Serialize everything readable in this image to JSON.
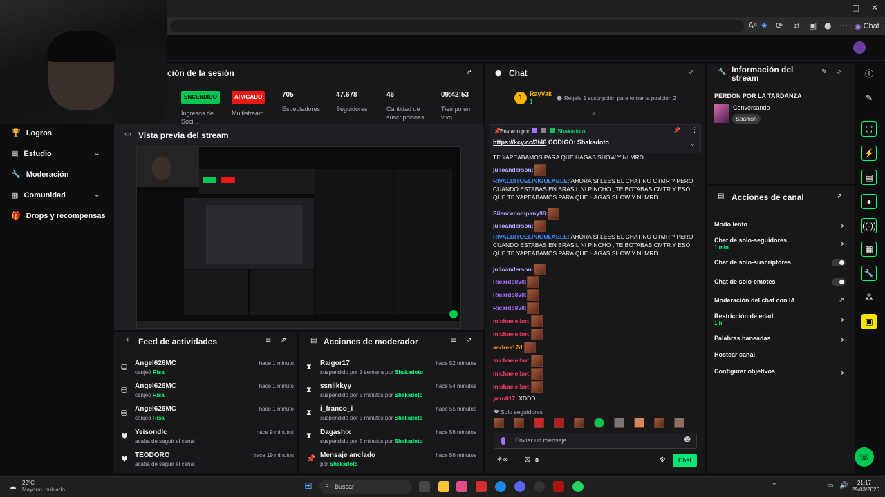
{
  "browser": {
    "chat_label": "Chat",
    "win_min": "—",
    "win_max": "□",
    "win_close": "✕"
  },
  "nav": {
    "items": [
      {
        "label": "Logros",
        "icon": "trophy-icon"
      },
      {
        "label": "Estudio",
        "icon": "studio-icon"
      },
      {
        "label": "Moderación",
        "icon": "wrench-icon"
      },
      {
        "label": "Comunidad",
        "icon": "community-icon"
      },
      {
        "label": "Drops y recompensas",
        "icon": "gift-icon"
      }
    ]
  },
  "session": {
    "title": "ción de la sesión",
    "stats": [
      {
        "value": "ENCENDIDO",
        "label": "Ingresos de Soci..."
      },
      {
        "value": "APAGADO",
        "label": "Multistream"
      },
      {
        "value": "705",
        "label": "Espectadores"
      },
      {
        "value": "47.678",
        "label": "Seguidores"
      },
      {
        "value": "46",
        "label": "Cantidad de suscripciones"
      },
      {
        "value": "09:42:53",
        "label": "Tiempo en vivo"
      }
    ]
  },
  "preview": {
    "title": "Vista previa del stream"
  },
  "feed": {
    "title": "Feed de actividades",
    "rows": [
      {
        "name": "Angel626MC",
        "sub": "canjeó",
        "highlight": "Risa",
        "time": "hace 1 minuto"
      },
      {
        "name": "Angel626MC",
        "sub": "canjeó",
        "highlight": "Risa",
        "time": "hace 1 minuto"
      },
      {
        "name": "Angel626MC",
        "sub": "canjeó",
        "highlight": "Risa",
        "time": "hace 1 minuto"
      },
      {
        "name": "Yeisondlc",
        "sub": "acaba de seguir el canal",
        "highlight": "",
        "time": "hace 9 minutos"
      },
      {
        "name": "TEODORO",
        "sub": "acaba de seguir el canal",
        "highlight": "",
        "time": "hace 19 minutos"
      }
    ]
  },
  "mod": {
    "title": "Acciones de moderador",
    "rows": [
      {
        "name": "Raigor17",
        "sub": "suspendido por 1 semana por",
        "by": "Shakadoto",
        "time": "hace 52 minutos"
      },
      {
        "name": "ssnilkkyy",
        "sub": "suspendido por 5 minutos por",
        "by": "Shakadoto",
        "time": "hace 54 minutos"
      },
      {
        "name": "i_franco_i",
        "sub": "suspendido por 5 minutos por",
        "by": "Shakadoto",
        "time": "hace 55 minutos"
      },
      {
        "name": "Dagashix",
        "sub": "suspendido por 5 minutos por",
        "by": "Shakadoto",
        "time": "hace 56 minutos"
      },
      {
        "name": "Mensaje anclado",
        "sub": "por",
        "by": "Shakadoto",
        "time": "hace 56 minutos"
      }
    ]
  },
  "chat": {
    "title": "Chat",
    "top_user": "RayVak",
    "top_rank": "1",
    "top_count": "1",
    "gift_text": "Regala 1 suscripción para tomar la posición 2",
    "pinned_by_label": "Enviado por",
    "pinned_user": "Shakadoto",
    "pinned_link": "https://kcy.cc/3f46",
    "pinned_text": " CODIGO: Shakadoto",
    "partial_line": "TE YAPEABAMOS PARA QUE HAGAS SHOW Y NI MRD",
    "messages": [
      {
        "user": "julioanderson:",
        "color": "#b9a3ff",
        "text": "",
        "emote": true
      },
      {
        "user": "RIVALDITOELINIGULABLE:",
        "color": "#3d8cff",
        "text": " AHORA SI LEES EL CHAT NO CTMR ? PERO CUANDO ESTABAS EN BRASIL NI PINCHO , TE BOTABAS CMTR Y ESO QUE TE YAPEABAMOS PARA QUE HAGAS SHOW Y NI MRD",
        "emote": false
      },
      {
        "user": "Silencecompany96:",
        "color": "#b9a3ff",
        "text": "",
        "emote": true
      },
      {
        "user": "julioanderson:",
        "color": "#b9a3ff",
        "text": "",
        "emote": true
      },
      {
        "user": "RIVALDITOELINIGULABLE:",
        "color": "#3d8cff",
        "text": " AHORA SI LEES EL CHAT NO CTMR ? PERO CUANDO ESTABAS EN BRASIL NI PINCHO , TE BOTABAS CMTR Y ESO QUE TE YAPEABAMOS PARA QUE HAGAS SHOW Y NI MRD",
        "emote": false
      },
      {
        "user": "julioanderson:",
        "color": "#b9a3ff",
        "text": "",
        "emote": true
      },
      {
        "user": "Ricardo8v8:",
        "color": "#a970ff",
        "text": "",
        "emote": true
      },
      {
        "user": "Ricardo8v8:",
        "color": "#a970ff",
        "text": "",
        "emote": true
      },
      {
        "user": "Ricardo8v8:",
        "color": "#a970ff",
        "text": "",
        "emote": true
      },
      {
        "user": "michaelelbot:",
        "color": "#ff3b6b",
        "text": "",
        "emote": true
      },
      {
        "user": "michaelelbot:",
        "color": "#ff3b6b",
        "text": "",
        "emote": true
      },
      {
        "user": "andres17d:",
        "color": "#ff8c1a",
        "text": "",
        "emote": true
      },
      {
        "user": "michaelelbot:",
        "color": "#ff3b6b",
        "text": "",
        "emote": true
      },
      {
        "user": "michaelelbot:",
        "color": "#ff3b6b",
        "text": "",
        "emote": true
      },
      {
        "user": "michaelelbot:",
        "color": "#ff3b6b",
        "text": "",
        "emote": true
      },
      {
        "user": "yero017:",
        "color": "#ff3b6b",
        "text": " XDDD",
        "emote": false
      }
    ],
    "followers_only": "Solo seguidores",
    "placeholder": "Enviar un mensaje",
    "points": "0",
    "send_label": "Chat"
  },
  "stream_info": {
    "title": "Información del stream",
    "stream_title": "PERDON POR LA TARDANZA",
    "category": "Conversando",
    "language": "Spanish"
  },
  "channel_actions": {
    "title": "Acciones de canal",
    "items": [
      {
        "label": "Modo lento",
        "sub": "",
        "control": "arrow"
      },
      {
        "label": "Chat de solo-seguidores",
        "sub": "1 min",
        "control": "arrow"
      },
      {
        "label": "Chat de solo-suscriptores",
        "sub": "",
        "control": "toggle"
      },
      {
        "label": "Chat de solo-emotes",
        "sub": "",
        "control": "toggle"
      },
      {
        "label": "Moderación del chat con IA",
        "sub": "",
        "control": "external"
      },
      {
        "label": "Restricción de edad",
        "sub": "1 h",
        "control": "arrow"
      },
      {
        "label": "Palabras baneadas",
        "sub": "",
        "control": "arrow"
      },
      {
        "label": "Hostear canal",
        "sub": "",
        "control": "none"
      },
      {
        "label": "Configurar objetivos",
        "sub": "",
        "control": "arrow"
      }
    ]
  },
  "taskbar": {
    "weather_temp": "22°C",
    "weather_desc": "Mayorm. nublado",
    "search_label": "Buscar",
    "time": "21:17",
    "date": "29/03/2026"
  },
  "colors": {
    "accent": "#00ff7f",
    "bg": "#0e0e10",
    "panel": "#18181b",
    "on": "#00ff7f",
    "off": "#e91916"
  }
}
